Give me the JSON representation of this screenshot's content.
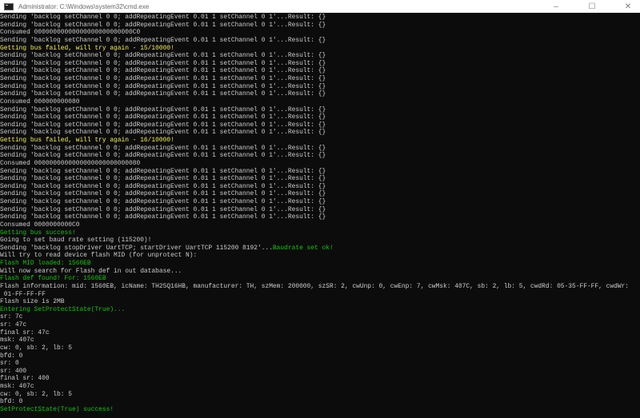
{
  "window": {
    "title": "Administrator: C:\\Windows\\system32\\cmd.exe",
    "minimize": "–",
    "maximize": "☐",
    "close": "✕"
  },
  "colors": {
    "text": "#cccccc",
    "warning": "#f3f05a",
    "success": "#16c60c",
    "background": "#0c0c0c"
  },
  "lines": [
    {
      "t": "Sending 'backlog setChannel 0 0; addRepeatingEvent 0.01 1 setChannel 0 1'...Result: {}",
      "c": ""
    },
    {
      "t": "Sending 'backlog setChannel 0 0; addRepeatingEvent 0.01 1 setChannel 0 1'...Result: {}",
      "c": ""
    },
    {
      "t": "Consumed 00000000000000000000000000C0",
      "c": ""
    },
    {
      "t": "Sending 'backlog setChannel 0 0; addRepeatingEvent 0.01 1 setChannel 0 1'...Result: {}",
      "c": ""
    },
    {
      "t": "Getting bus failed, will try again - 15/10000!",
      "c": "y"
    },
    {
      "t": "Sending 'backlog setChannel 0 0; addRepeatingEvent 0.01 1 setChannel 0 1'...Result: {}",
      "c": ""
    },
    {
      "t": "Sending 'backlog setChannel 0 0; addRepeatingEvent 0.01 1 setChannel 0 1'...Result: {}",
      "c": ""
    },
    {
      "t": "Sending 'backlog setChannel 0 0; addRepeatingEvent 0.01 1 setChannel 0 1'...Result: {}",
      "c": ""
    },
    {
      "t": "Sending 'backlog setChannel 0 0; addRepeatingEvent 0.01 1 setChannel 0 1'...Result: {}",
      "c": ""
    },
    {
      "t": "Sending 'backlog setChannel 0 0; addRepeatingEvent 0.01 1 setChannel 0 1'...Result: {}",
      "c": ""
    },
    {
      "t": "Sending 'backlog setChannel 0 0; addRepeatingEvent 0.01 1 setChannel 0 1'...Result: {}",
      "c": ""
    },
    {
      "t": "Consumed 000000000080",
      "c": ""
    },
    {
      "t": "Sending 'backlog setChannel 0 0; addRepeatingEvent 0.01 1 setChannel 0 1'...Result: {}",
      "c": ""
    },
    {
      "t": "Sending 'backlog setChannel 0 0; addRepeatingEvent 0.01 1 setChannel 0 1'...Result: {}",
      "c": ""
    },
    {
      "t": "Sending 'backlog setChannel 0 0; addRepeatingEvent 0.01 1 setChannel 0 1'...Result: {}",
      "c": ""
    },
    {
      "t": "Sending 'backlog setChannel 0 0; addRepeatingEvent 0.01 1 setChannel 0 1'...Result: {}",
      "c": ""
    },
    {
      "t": "Getting bus failed, will try again - 16/10000!",
      "c": "y"
    },
    {
      "t": "Sending 'backlog setChannel 0 0; addRepeatingEvent 0.01 1 setChannel 0 1'...Result: {}",
      "c": ""
    },
    {
      "t": "Sending 'backlog setChannel 0 0; addRepeatingEvent 0.01 1 setChannel 0 1'...Result: {}",
      "c": ""
    },
    {
      "t": "Consumed 0000000000000000000000000080",
      "c": ""
    },
    {
      "t": "Sending 'backlog setChannel 0 0; addRepeatingEvent 0.01 1 setChannel 0 1'...Result: {}",
      "c": ""
    },
    {
      "t": "Sending 'backlog setChannel 0 0; addRepeatingEvent 0.01 1 setChannel 0 1'...Result: {}",
      "c": ""
    },
    {
      "t": "Sending 'backlog setChannel 0 0; addRepeatingEvent 0.01 1 setChannel 0 1'...Result: {}",
      "c": ""
    },
    {
      "t": "Sending 'backlog setChannel 0 0; addRepeatingEvent 0.01 1 setChannel 0 1'...Result: {}",
      "c": ""
    },
    {
      "t": "Sending 'backlog setChannel 0 0; addRepeatingEvent 0.01 1 setChannel 0 1'...Result: {}",
      "c": ""
    },
    {
      "t": "Sending 'backlog setChannel 0 0; addRepeatingEvent 0.01 1 setChannel 0 1'...Result: {}",
      "c": ""
    },
    {
      "t": "Sending 'backlog setChannel 0 0; addRepeatingEvent 0.01 1 setChannel 0 1'...Result: {}",
      "c": ""
    },
    {
      "t": "Consumed 0000000000C0",
      "c": ""
    },
    {
      "t": "Getting bus success!",
      "c": "g"
    },
    {
      "t": "Going to set baud rate setting (115200)!",
      "c": ""
    },
    {
      "t": "Sending 'backlog stopDriver UartTCP; startDriver UartTCP 115200 8192'...",
      "c": "",
      "suffix": "Baudrate set ok!"
    },
    {
      "t": "Will try to read device flash MID (for unprotect N):",
      "c": ""
    },
    {
      "t": "Flash MID loaded: 1560EB",
      "c": "g"
    },
    {
      "t": "Will now search for Flash def in out database...",
      "c": ""
    },
    {
      "t": "Flash def found! For: 1560EB",
      "c": "g"
    },
    {
      "t": "Flash information: mid: 1560EB, icName: TH25Q16HB, manufacturer: TH, szMem: 200000, szSR: 2, cwUnp: 0, cwEnp: 7, cwMsk: 407C, sb: 2, lb: 5, cwdRd: 05-35-FF-FF, cwdWr:",
      "c": ""
    },
    {
      "t": " 01-FF-FF-FF",
      "c": ""
    },
    {
      "t": "Flash size is 2MB",
      "c": ""
    },
    {
      "t": "Entering SetProtectState(True)...",
      "c": "g"
    },
    {
      "t": "sr: 7c",
      "c": ""
    },
    {
      "t": "sr: 47c",
      "c": ""
    },
    {
      "t": "final sr: 47c",
      "c": ""
    },
    {
      "t": "msk: 407c",
      "c": ""
    },
    {
      "t": "cw: 0, sb: 2, lb: 5",
      "c": ""
    },
    {
      "t": "bfd: 0",
      "c": ""
    },
    {
      "t": "sr: 0",
      "c": ""
    },
    {
      "t": "sr: 400",
      "c": ""
    },
    {
      "t": "final sr: 400",
      "c": ""
    },
    {
      "t": "msk: 407c",
      "c": ""
    },
    {
      "t": "cw: 0, sb: 2, lb: 5",
      "c": ""
    },
    {
      "t": "bfd: 0",
      "c": ""
    },
    {
      "t": "SetProtectState(True) success!",
      "c": "g"
    }
  ]
}
